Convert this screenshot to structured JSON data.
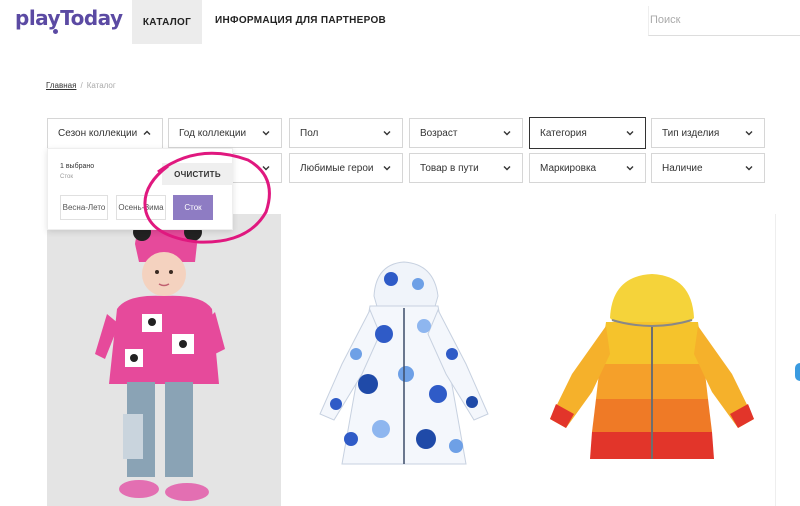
{
  "header": {
    "logo": "playToday",
    "nav": {
      "catalog": "КАТАЛОГ",
      "partners": "ИНФОРМАЦИЯ ДЛЯ ПАРТНЕРОВ"
    },
    "search_placeholder": "Поиск"
  },
  "breadcrumb": {
    "home": "Главная",
    "separator": "/",
    "current": "Каталог"
  },
  "filters": {
    "row1": [
      "Сезон коллекции",
      "Год коллекции",
      "Пол",
      "Возраст",
      "Категория",
      "Тип изделия"
    ],
    "row2": [
      "",
      "Любимые герои",
      "Товар в пути",
      "Маркировка",
      "Наличие"
    ]
  },
  "dropdown": {
    "selected_count": "1 выбрано",
    "selected_value": "Сток",
    "clear_label": "ОЧИСТИТЬ",
    "options": [
      "Весна-Лето",
      "Осень-Зима",
      "Сток"
    ],
    "selected_option": "Сток"
  },
  "colors": {
    "brand": "#5b4aa3",
    "selected_option_bg": "#8e7cc3",
    "highlight": "#e0187f"
  },
  "products": [
    {
      "name": "girl-in-pink-minnie-outfit"
    },
    {
      "name": "blue-floral-coat"
    },
    {
      "name": "yellow-orange-red-puffer-jacket"
    }
  ]
}
